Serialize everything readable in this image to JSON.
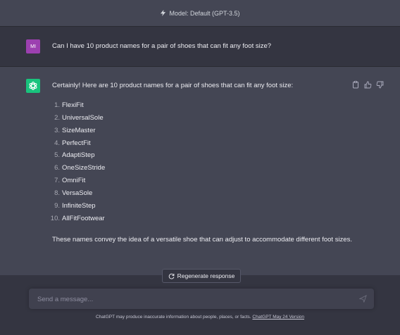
{
  "header": {
    "model_label": "Model: Default (GPT-3.5)"
  },
  "user_message": {
    "avatar_initials": "MI",
    "text": "Can I have 10 product names for a pair of shoes that can fit any foot size?"
  },
  "assistant_message": {
    "intro": "Certainly! Here are 10 product names for a pair of shoes that can fit any foot size:",
    "items": [
      {
        "num": "1.",
        "name": "FlexiFit"
      },
      {
        "num": "2.",
        "name": "UniversalSole"
      },
      {
        "num": "3.",
        "name": "SizeMaster"
      },
      {
        "num": "4.",
        "name": "PerfectFit"
      },
      {
        "num": "5.",
        "name": "AdaptiStep"
      },
      {
        "num": "6.",
        "name": "OneSizeStride"
      },
      {
        "num": "7.",
        "name": "OmniFit"
      },
      {
        "num": "8.",
        "name": "VersaSole"
      },
      {
        "num": "9.",
        "name": "InfiniteStep"
      },
      {
        "num": "10.",
        "name": "AllFitFootwear"
      }
    ],
    "summary": "These names convey the idea of a versatile shoe that can adjust to accommodate different foot sizes."
  },
  "actions": {
    "icons": [
      "clipboard-icon",
      "thumbs-up-icon",
      "thumbs-down-icon"
    ]
  },
  "regenerate": {
    "label": "Regenerate response"
  },
  "composer": {
    "placeholder": "Send a message..."
  },
  "footer": {
    "disclaimer": "ChatGPT may produce inaccurate information about people, places, or facts. ",
    "version_link": "ChatGPT May 24 Version"
  },
  "colors": {
    "background": "#343541",
    "assistant_background": "#444654",
    "user_avatar": "#9c40b0",
    "assistant_avatar": "#19c37d",
    "input_background": "#40414f"
  }
}
